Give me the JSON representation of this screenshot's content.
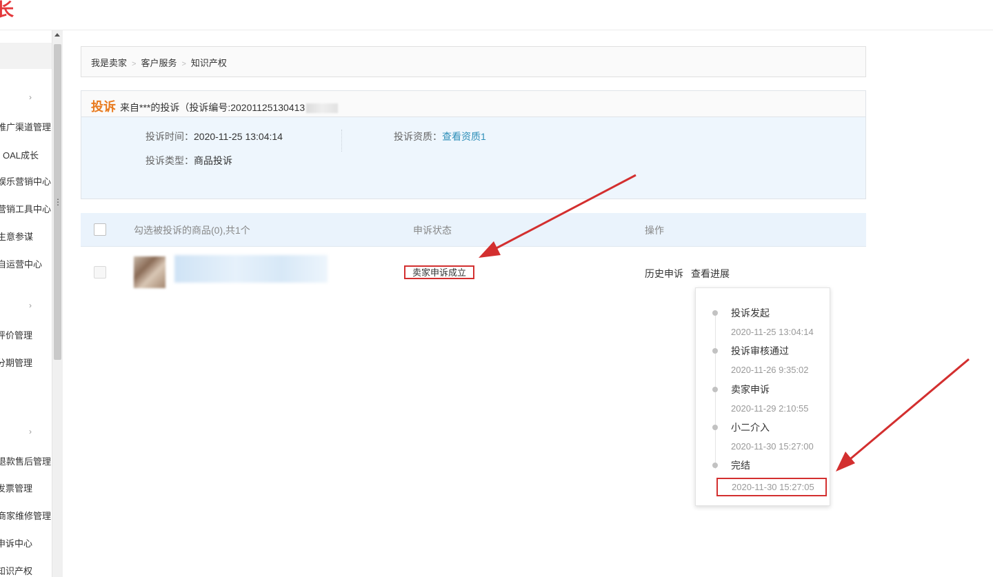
{
  "topbar": {
    "logo_fragment": "长"
  },
  "sidebar": {
    "items": [
      {
        "label": "推广渠道管理"
      },
      {
        "label": "OAL成长"
      },
      {
        "label": "娱乐营销中心"
      },
      {
        "label": "营销工具中心"
      },
      {
        "label": "生意参谋"
      },
      {
        "label": "自运营中心"
      },
      {
        "label": "评价管理"
      },
      {
        "label": "分期管理"
      },
      {
        "label": "退款售后管理"
      },
      {
        "label": "发票管理"
      },
      {
        "label": "商家维修管理"
      },
      {
        "label": "申诉中心"
      },
      {
        "label": "知识产权"
      }
    ],
    "chevron": "›",
    "grip": "⋮"
  },
  "breadcrumb": {
    "items": [
      "我是卖家",
      "客户服务",
      "知识产权"
    ],
    "separator": ">"
  },
  "complaint": {
    "kind": "投诉",
    "header_text": "来自***的投诉（投诉编号:20201125130413",
    "time_label": "投诉时间：",
    "time_value": "2020-11-25 13:04:14",
    "qual_label": "投诉资质：",
    "qual_link": "查看资质1",
    "type_label": "投诉类型：",
    "type_value": "商品投诉"
  },
  "table": {
    "headers": {
      "select": "勾选被投诉的商品(0),共1个",
      "status": "申诉状态",
      "action": "操作"
    },
    "row": {
      "status": "卖家申诉成立",
      "actions": [
        "历史申诉",
        "查看进展"
      ]
    }
  },
  "progress": {
    "steps": [
      {
        "title": "投诉发起",
        "time": "2020-11-25 13:04:14"
      },
      {
        "title": "投诉审核通过",
        "time": "2020-11-26 9:35:02"
      },
      {
        "title": "卖家申诉",
        "time": "2020-11-29 2:10:55"
      },
      {
        "title": "小二介入",
        "time": "2020-11-30 15:27:00"
      },
      {
        "title": "完结",
        "time": "2020-11-30 15:27:05"
      }
    ]
  },
  "colors": {
    "annotation_red": "#d32f2f",
    "accent_orange": "#e87a1e",
    "link_blue": "#2e8fb9"
  }
}
